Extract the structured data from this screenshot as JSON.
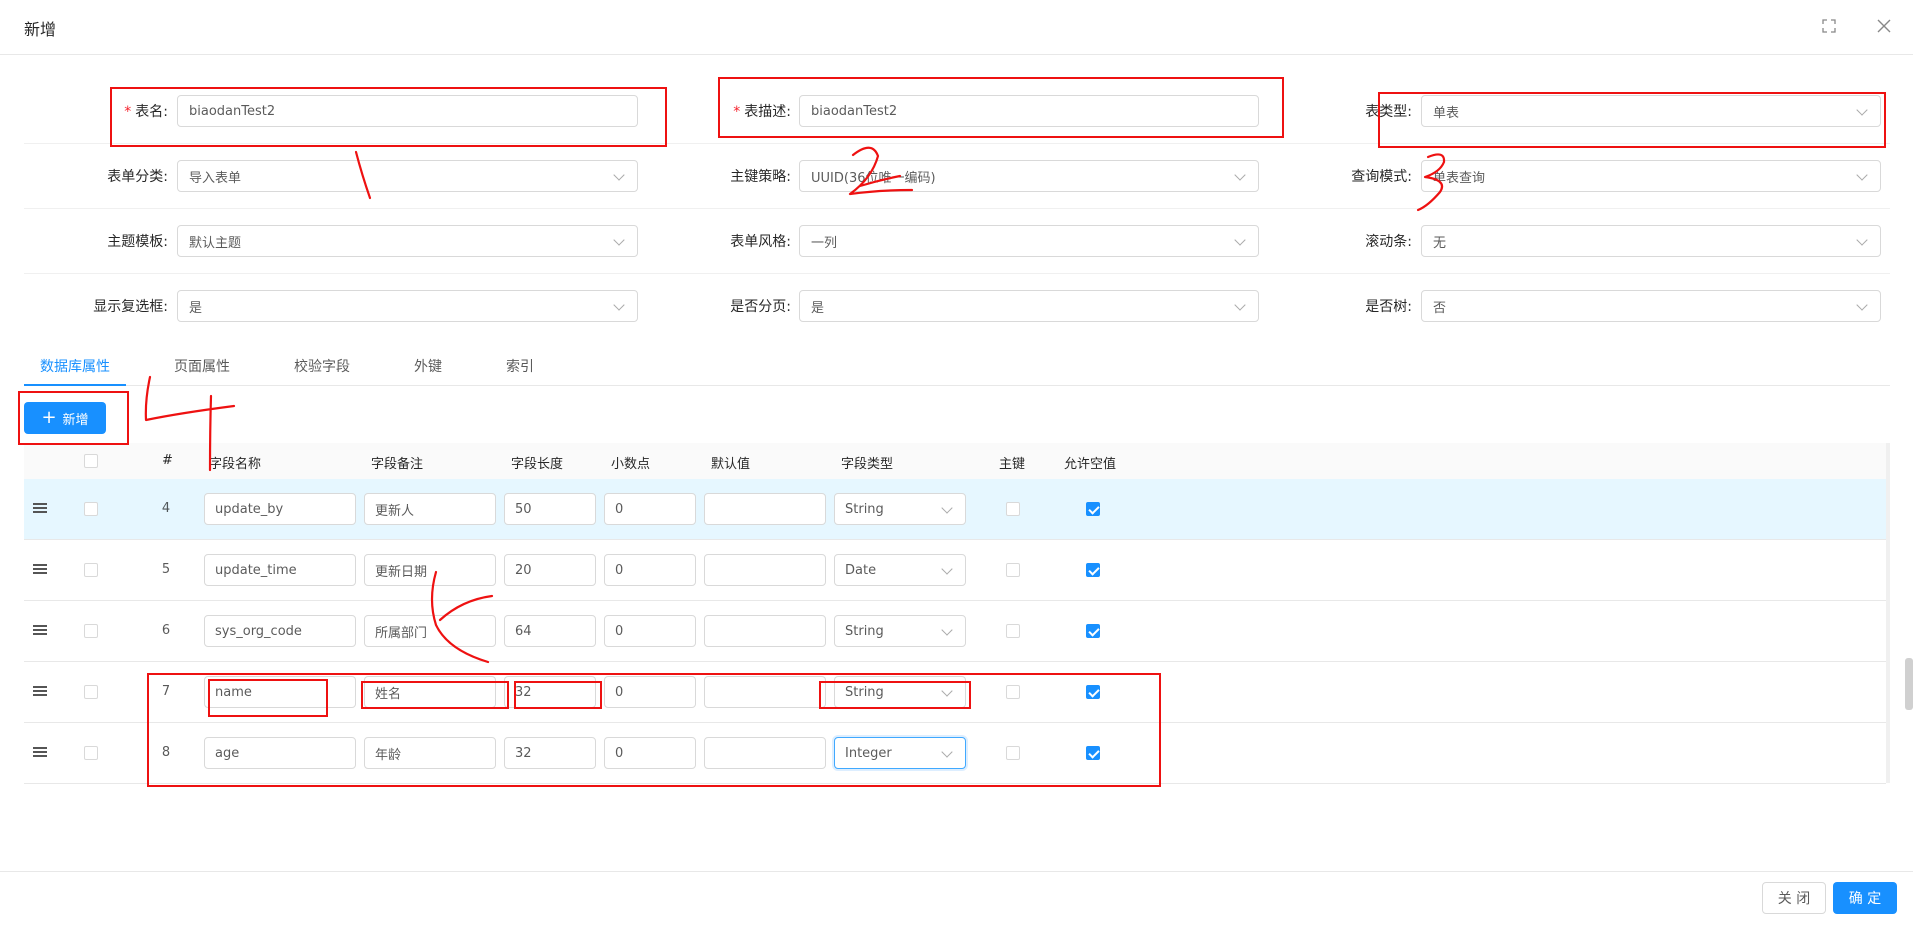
{
  "modal": {
    "title": "新增"
  },
  "form": {
    "table_name": {
      "label": "表名:",
      "value": "biaodanTest2"
    },
    "table_desc": {
      "label": "表描述:",
      "value": "biaodanTest2"
    },
    "table_type": {
      "label": "表类型:",
      "value": "单表"
    },
    "form_category": {
      "label": "表单分类:",
      "value": "导入表单"
    },
    "pk_strategy": {
      "label": "主键策略:",
      "value": "UUID(36位唯一编码)"
    },
    "query_mode": {
      "label": "查询模式:",
      "value": "单表查询"
    },
    "theme": {
      "label": "主题模板:",
      "value": "默认主题"
    },
    "form_style": {
      "label": "表单风格:",
      "value": "一列"
    },
    "scrollbar": {
      "label": "滚动条:",
      "value": "无"
    },
    "show_checkbox": {
      "label": "显示复选框:",
      "value": "是"
    },
    "paginate": {
      "label": "是否分页:",
      "value": "是"
    },
    "is_tree": {
      "label": "是否树:",
      "value": "否"
    }
  },
  "tabs": [
    "数据库属性",
    "页面属性",
    "校验字段",
    "外键",
    "索引"
  ],
  "add_button": "新增",
  "table": {
    "headers": {
      "index": "#",
      "field_name": "字段名称",
      "remark": "字段备注",
      "length": "字段长度",
      "decimal": "小数点",
      "default": "默认值",
      "type": "字段类型",
      "pk": "主键",
      "nullable": "允许空值"
    },
    "rows": [
      {
        "num": "4",
        "field_name": "update_by",
        "remark": "更新人",
        "length": "50",
        "decimal": "0",
        "default": "",
        "type": "String",
        "pk": false,
        "nullable": true
      },
      {
        "num": "5",
        "field_name": "update_time",
        "remark": "更新日期",
        "length": "20",
        "decimal": "0",
        "default": "",
        "type": "Date",
        "pk": false,
        "nullable": true
      },
      {
        "num": "6",
        "field_name": "sys_org_code",
        "remark": "所属部门",
        "length": "64",
        "decimal": "0",
        "default": "",
        "type": "String",
        "pk": false,
        "nullable": true
      },
      {
        "num": "7",
        "field_name": "name",
        "remark": "姓名",
        "length": "32",
        "decimal": "0",
        "default": "",
        "type": "String",
        "pk": false,
        "nullable": true
      },
      {
        "num": "8",
        "field_name": "age",
        "remark": "年龄",
        "length": "32",
        "decimal": "0",
        "default": "",
        "type": "Integer",
        "pk": false,
        "nullable": true
      }
    ]
  },
  "footer": {
    "close": "关 闭",
    "ok": "确 定"
  },
  "colors": {
    "primary": "#1890ff",
    "annotation": "#ee1111",
    "required": "#f5222d"
  }
}
